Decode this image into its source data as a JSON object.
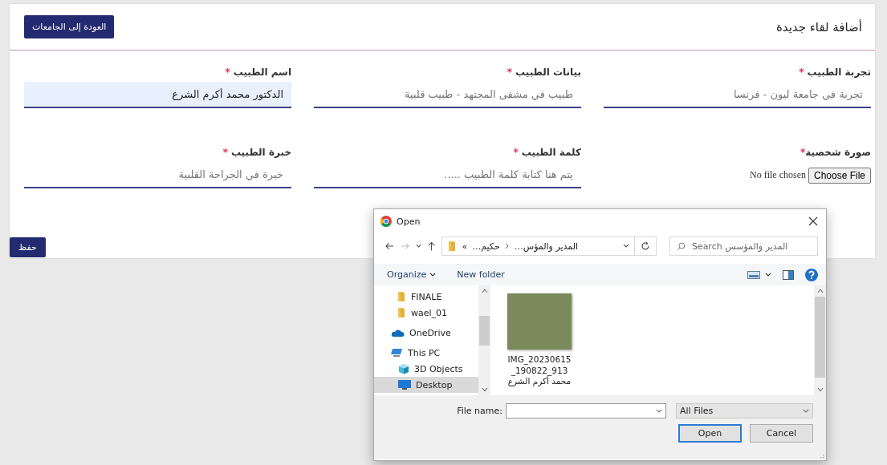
{
  "header": {
    "title": "أضافة لقاء جديدة",
    "back_button": "العودة إلى الجامعات"
  },
  "fields": [
    {
      "kind": "text",
      "label": "تجربة الطبيب",
      "required_mark": "*",
      "placeholder": "تجربة في جامعة ليون - فرنسا",
      "autofilled": false
    },
    {
      "kind": "text",
      "label": "بيانات الطبيب",
      "required_mark": "*",
      "placeholder": "طبيب في مشفى المجتهد - طبيب قلبية",
      "autofilled": false
    },
    {
      "kind": "text",
      "label": "اسم الطبيب",
      "required_mark": "*",
      "value": "الدكتور محمد أكرم الشرع",
      "autofilled": true
    },
    {
      "kind": "file",
      "label": "صورة شخصية",
      "required_mark": "*",
      "button": "Choose File",
      "status": "No file chosen"
    },
    {
      "kind": "text",
      "label": "كلمة الطبيب",
      "required_mark": "*",
      "placeholder": "يتم هنا كتابة كلمة الطبيب .....",
      "autofilled": false
    },
    {
      "kind": "text",
      "label": "خبرة الطبيب",
      "required_mark": "*",
      "placeholder": "خبرة في الجراحة القلبية",
      "autofilled": false
    }
  ],
  "save_button": "حفظ",
  "dialog": {
    "title": "Open",
    "breadcrumb": {
      "overflow": "«",
      "parent_folder": "حكيم…",
      "current_folder": "المدير والمؤس…"
    },
    "search_placeholder": "Search المدير والمؤسس",
    "toolbar": {
      "organize": "Organize",
      "new_folder": "New folder"
    },
    "sidebar": [
      {
        "kind": "folder",
        "label": "FINALE",
        "selected": false
      },
      {
        "kind": "folder",
        "label": "wael_01",
        "selected": false
      },
      {
        "kind": "cloud",
        "label": "OneDrive",
        "selected": false
      },
      {
        "kind": "pc",
        "label": "This PC",
        "selected": false,
        "children": [
          {
            "kind": "cube",
            "label": "3D Objects",
            "selected": false
          },
          {
            "kind": "desktop",
            "label": "Desktop",
            "selected": true
          }
        ]
      }
    ],
    "files": [
      {
        "name": "IMG_20230615_190822_913 محمد أكرم الشرع"
      }
    ],
    "file_name_label": "File name:",
    "filter": "All Files",
    "open_button": {
      "label": "Open",
      "default": true
    },
    "cancel_button": {
      "label": "Cancel",
      "default": false
    }
  }
}
